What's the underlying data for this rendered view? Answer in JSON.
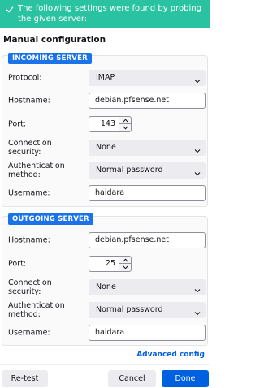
{
  "banner": {
    "message": "The following settings were found by probing the given server:",
    "icon": "check-icon",
    "color": "#2ac3a2"
  },
  "manual_title": "Manual configuration",
  "incoming": {
    "badge": "INCOMING SERVER",
    "protocol_label": "Protocol:",
    "protocol_value": "IMAP",
    "hostname_label": "Hostname:",
    "hostname_value": "debian.pfsense.net",
    "port_label": "Port:",
    "port_value": "143",
    "security_label": "Connection security:",
    "security_value": "None",
    "auth_label": "Authentication method:",
    "auth_value": "Normal password",
    "username_label": "Username:",
    "username_value": "haidara"
  },
  "outgoing": {
    "badge": "OUTGOING SERVER",
    "hostname_label": "Hostname:",
    "hostname_value": "debian.pfsense.net",
    "port_label": "Port:",
    "port_value": "25",
    "security_label": "Connection security:",
    "security_value": "None",
    "auth_label": "Authentication method:",
    "auth_value": "Normal password",
    "username_label": "Username:",
    "username_value": "haidara"
  },
  "advanced_link": "Advanced config",
  "buttons": {
    "retest": "Re-test",
    "cancel": "Cancel",
    "done": "Done"
  },
  "colors": {
    "accent": "#0061e0",
    "badge": "#1a73e8"
  }
}
